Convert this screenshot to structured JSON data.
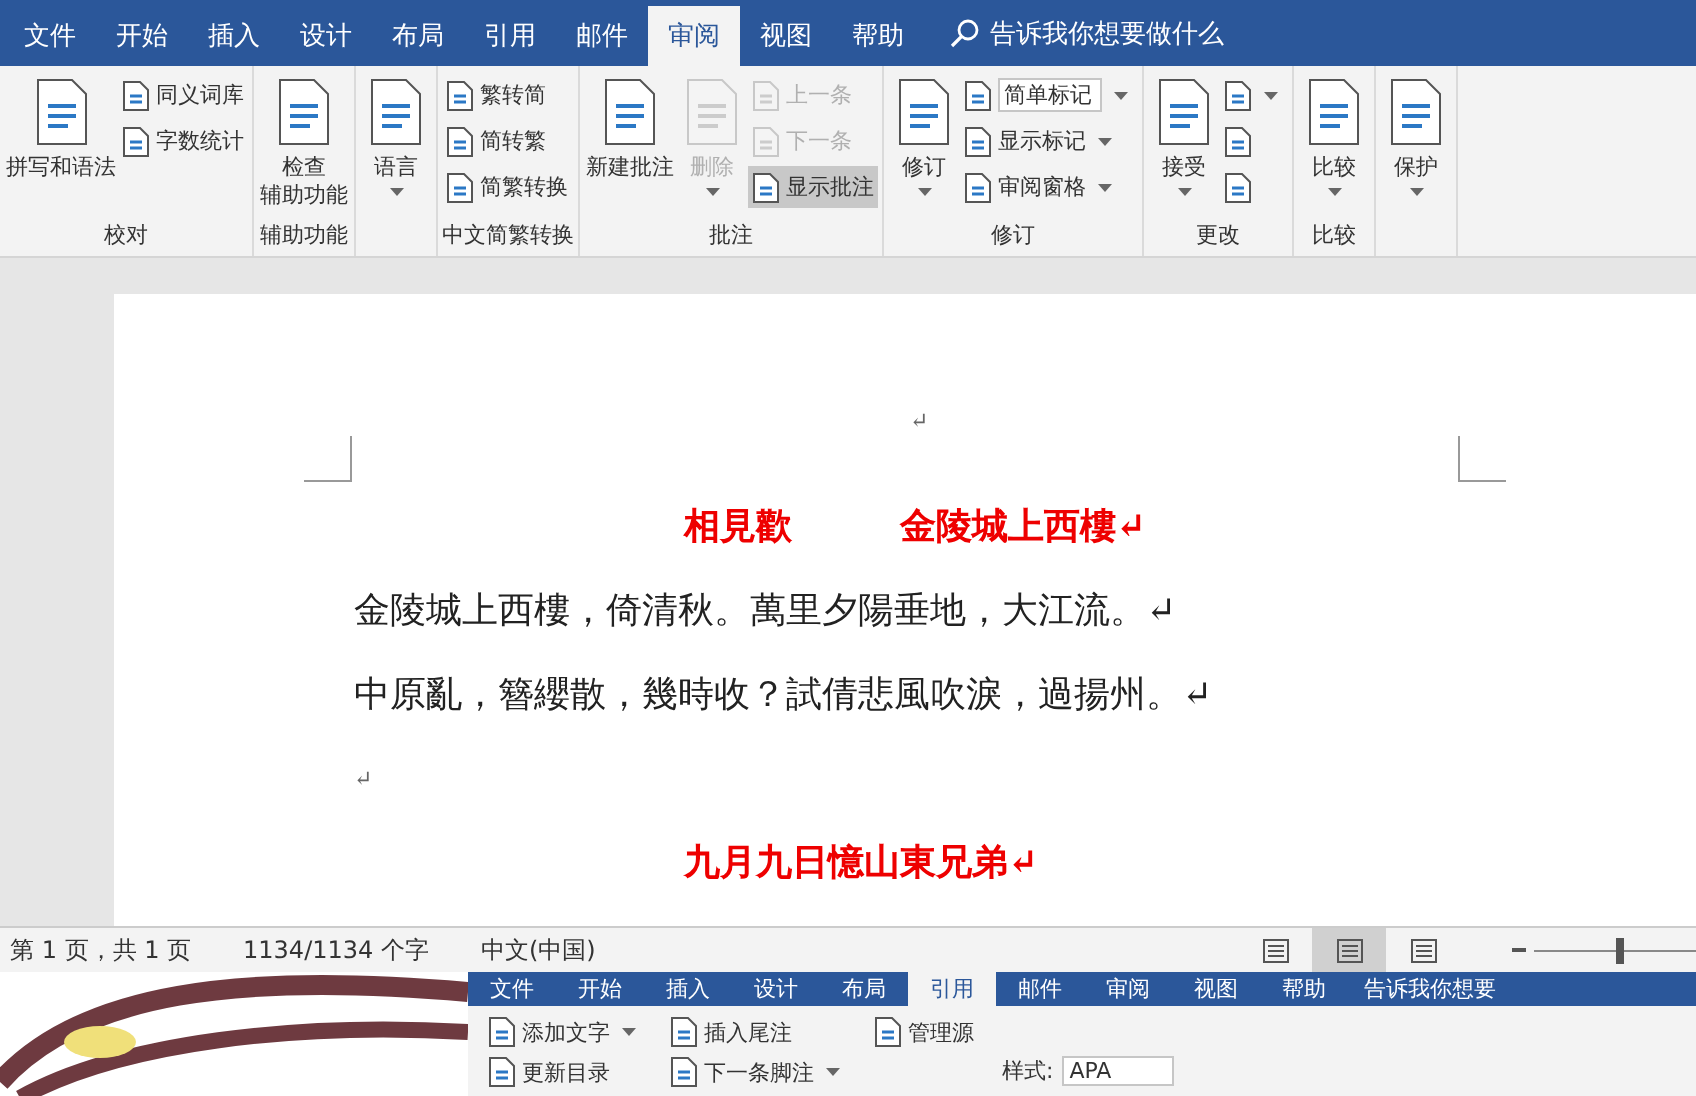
{
  "tabs": [
    {
      "label": "文件",
      "selected": false
    },
    {
      "label": "开始",
      "selected": false
    },
    {
      "label": "插入",
      "selected": false
    },
    {
      "label": "设计",
      "selected": false
    },
    {
      "label": "布局",
      "selected": false
    },
    {
      "label": "引用",
      "selected": false
    },
    {
      "label": "邮件",
      "selected": false
    },
    {
      "label": "审阅",
      "selected": true
    },
    {
      "label": "视图",
      "selected": false
    },
    {
      "label": "帮助",
      "selected": false
    }
  ],
  "tell_me": "告诉我你想要做什么",
  "ribbon_groups": [
    {
      "label": "校对",
      "items": [
        {
          "kind": "large",
          "lines": [
            "拼写和语法"
          ],
          "dropdown": false,
          "disabled": false,
          "on": false
        },
        {
          "kind": "small",
          "lines": [
            "同义词库"
          ],
          "dropdown": false,
          "disabled": false,
          "on": false
        },
        {
          "kind": "small",
          "lines": [
            "字数统计"
          ],
          "dropdown": false,
          "disabled": false,
          "on": false
        }
      ]
    },
    {
      "label": "辅助功能",
      "items": [
        {
          "kind": "large",
          "lines": [
            "检查",
            "辅助功能"
          ],
          "dropdown": false,
          "disabled": false,
          "on": false
        }
      ]
    },
    {
      "items": [
        {
          "kind": "large",
          "lines": [
            "语言"
          ],
          "dropdown": true,
          "disabled": false,
          "on": false
        }
      ]
    },
    {
      "label": "中文简繁转换",
      "items": [
        {
          "kind": "small",
          "lines": [
            "繁转简"
          ],
          "dropdown": false,
          "disabled": false,
          "on": false
        },
        {
          "kind": "small",
          "lines": [
            "简转繁"
          ],
          "dropdown": false,
          "disabled": false,
          "on": false
        },
        {
          "kind": "small",
          "lines": [
            "简繁转换"
          ],
          "dropdown": false,
          "disabled": false,
          "on": false
        }
      ]
    },
    {
      "label": "批注",
      "items": [
        {
          "kind": "large",
          "lines": [
            "新建批注"
          ],
          "dropdown": false,
          "disabled": false,
          "on": false
        },
        {
          "kind": "large",
          "lines": [
            "删除"
          ],
          "dropdown": true,
          "disabled": true,
          "on": false
        },
        {
          "kind": "small",
          "lines": [
            "上一条"
          ],
          "dropdown": false,
          "disabled": true,
          "on": false
        },
        {
          "kind": "small",
          "lines": [
            "下一条"
          ],
          "dropdown": false,
          "disabled": true,
          "on": false
        },
        {
          "kind": "small",
          "lines": [
            "显示批注"
          ],
          "dropdown": false,
          "disabled": false,
          "on": true
        }
      ]
    },
    {
      "label": "修订",
      "items": [
        {
          "kind": "large",
          "lines": [
            "修订"
          ],
          "dropdown": true,
          "disabled": false,
          "on": false
        },
        {
          "kind": "combo",
          "lines": [
            "简单标记"
          ],
          "dropdown": true,
          "disabled": false,
          "on": false
        },
        {
          "kind": "small",
          "lines": [
            "显示标记"
          ],
          "dropdown": true,
          "disabled": false,
          "on": false
        },
        {
          "kind": "small",
          "lines": [
            "审阅窗格"
          ],
          "dropdown": true,
          "disabled": false,
          "on": false
        }
      ]
    },
    {
      "label": "更改",
      "items": [
        {
          "kind": "large",
          "lines": [
            "接受"
          ],
          "dropdown": true,
          "disabled": false,
          "on": false
        },
        {
          "kind": "icon",
          "dropdown": true,
          "disabled": false,
          "on": false
        },
        {
          "kind": "icon",
          "dropdown": false,
          "disabled": false,
          "on": false
        },
        {
          "kind": "icon",
          "dropdown": false,
          "disabled": false,
          "on": false
        }
      ]
    },
    {
      "label": "比较",
      "items": [
        {
          "kind": "large",
          "lines": [
            "比较"
          ],
          "dropdown": true,
          "disabled": false,
          "on": false
        }
      ]
    },
    {
      "items": [
        {
          "kind": "large",
          "lines": [
            "保护"
          ],
          "dropdown": true,
          "disabled": false,
          "on": false
        }
      ]
    }
  ],
  "document": {
    "paragraphs": [
      {
        "kind": "blank",
        "text": "↵"
      },
      {
        "kind": "heading",
        "text": "相見歡　　　金陵城上西樓↵"
      },
      {
        "kind": "body",
        "text": "金陵城上西樓，倚清秋。萬里夕陽垂地，大江流。↵"
      },
      {
        "kind": "body",
        "text": "中原亂，簪纓散，幾時收？試倩悲風吹淚，過揚州。↵"
      },
      {
        "kind": "empty",
        "text": "↵"
      },
      {
        "kind": "heading",
        "text": "九月九日憶山東兄弟↵"
      }
    ]
  },
  "status_bar": {
    "page": "第 1 页，共 1 页",
    "words": "1134/1134 个字",
    "language": "中文(中国)",
    "views": [
      {
        "selected": false
      },
      {
        "selected": true
      },
      {
        "selected": false
      }
    ],
    "zoom": {
      "level": 0.5
    }
  },
  "second_window": {
    "tabs": [
      {
        "label": "文件",
        "selected": false
      },
      {
        "label": "开始",
        "selected": false
      },
      {
        "label": "插入",
        "selected": false
      },
      {
        "label": "设计",
        "selected": false
      },
      {
        "label": "布局",
        "selected": false
      },
      {
        "label": "引用",
        "selected": true
      },
      {
        "label": "邮件",
        "selected": false
      },
      {
        "label": "审阅",
        "selected": false
      },
      {
        "label": "视图",
        "selected": false
      },
      {
        "label": "帮助",
        "selected": false
      }
    ],
    "tell_me": "告诉我你想要",
    "commands": [
      {
        "label": "添加文字",
        "dropdown": true
      },
      {
        "label": "更新目录",
        "dropdown": false
      },
      {
        "label": "插入尾注",
        "dropdown": false
      },
      {
        "label": "下一条脚注",
        "dropdown": true
      },
      {
        "label": "管理源",
        "dropdown": false
      }
    ],
    "style_label": "样式:",
    "style_value": "APA"
  }
}
